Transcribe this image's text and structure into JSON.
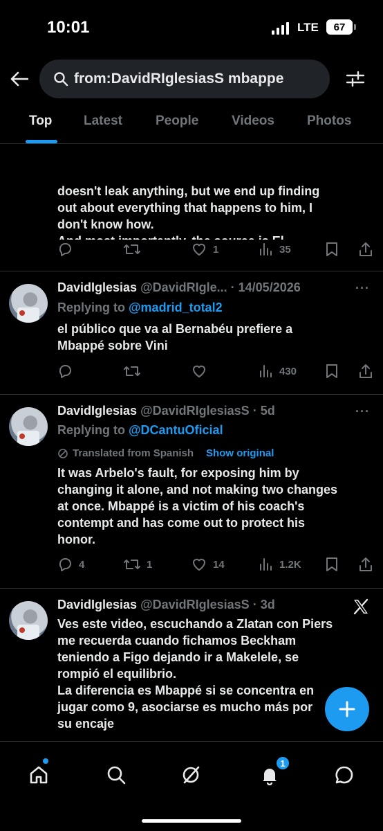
{
  "status": {
    "time": "10:01",
    "network": "LTE",
    "battery": "67"
  },
  "search": {
    "query": "from:DavidRIglesiasS mbappe"
  },
  "tabs": [
    {
      "label": "Top"
    },
    {
      "label": "Latest"
    },
    {
      "label": "People"
    },
    {
      "label": "Videos"
    },
    {
      "label": "Photos"
    }
  ],
  "tweets": [
    {
      "text": "doesn't leak anything, but we end up finding\nout about everything that happens to him, I\ndon't know how.\nAnd most importantly, the source is El\nChiringuito.",
      "replies": "",
      "retweets": "",
      "likes": "1",
      "views": "35"
    },
    {
      "name": "DavidIglesias",
      "handle": "@DavidRIgle... · 14/05/2026",
      "replying_label": "Replying to ",
      "replying_to": "@madrid_total2",
      "text": "el público que va al Bernabéu prefiere a\nMbappé sobre Vini",
      "replies": "",
      "retweets": "",
      "likes": "",
      "views": "430"
    },
    {
      "name": "DavidIglesias",
      "handle": "@DavidRIglesiasS · 5d",
      "replying_label": "Replying to ",
      "replying_to": "@DCantuOficial",
      "translated": "Translated from Spanish",
      "show_original": "Show original",
      "text": "It was Arbelo's fault, for exposing him by\nchanging it alone, and not making two changes\nat once. Mbappé is a victim of his coach's\ncontempt and has come out to protect his\nhonor.",
      "replies": "4",
      "retweets": "1",
      "likes": "14",
      "views": "1.2K"
    },
    {
      "name": "DavidIglesias",
      "handle": "@DavidRIglesiasS · 3d",
      "text": "Ves este video, escuchando a Zlatan con Piers\nme recuerda cuando fichamos Beckham\nteniendo a Figo dejando ir a Makelele, se\nrompió el equilibrio.\nLa diferencia es Mbappé si se concentra en\njugar como 9, asociarse es mucho más por\nsu encaje"
    }
  ],
  "nav": {
    "notifications_count": "1"
  },
  "colors": {
    "accent": "#1d9bf0",
    "muted": "#71767b",
    "text": "#e7e9ea",
    "background": "#000000"
  },
  "icons": [
    "back-arrow-icon",
    "search-icon",
    "filter-icon",
    "reply-icon",
    "retweet-icon",
    "like-icon",
    "views-icon",
    "bookmark-icon",
    "share-icon",
    "more-icon",
    "x-logo-icon",
    "compose-icon",
    "home-icon",
    "grok-icon",
    "bell-icon",
    "messages-icon"
  ]
}
